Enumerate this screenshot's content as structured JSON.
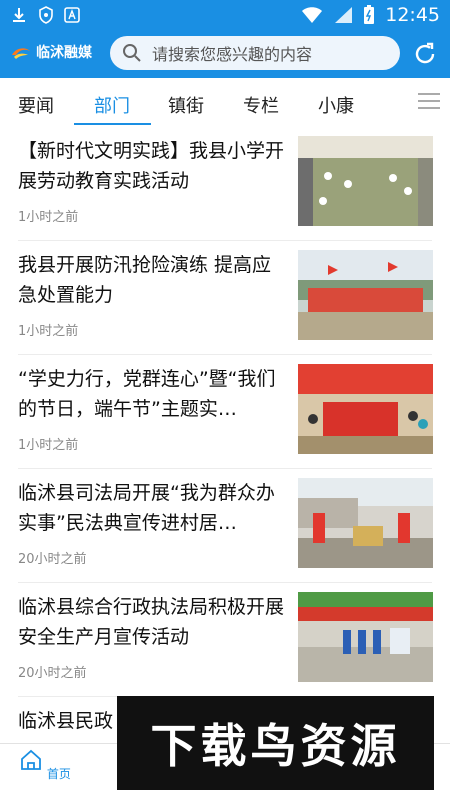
{
  "status_bar": {
    "time": "12:45"
  },
  "header": {
    "logo_text": "临沭融媒",
    "search_placeholder": "请搜索您感兴趣的内容"
  },
  "tabs": [
    {
      "label": "要闻"
    },
    {
      "label": "部门"
    },
    {
      "label": "镇街"
    },
    {
      "label": "专栏"
    },
    {
      "label": "小康"
    }
  ],
  "articles": [
    {
      "title": "【新时代文明实践】我县小学开展劳动教育实践活动",
      "time": "1小时之前"
    },
    {
      "title": "我县开展防汛抢险演练 提高应急处置能力",
      "time": "1小时之前"
    },
    {
      "title": "“学史力行，党群连心”暨“我们的节日，端午节”主题实…",
      "time": "1小时之前"
    },
    {
      "title": "临沭县司法局开展“我为群众办实事”民法典宣传进村居…",
      "time": "20小时之前"
    },
    {
      "title": "临沭县综合行政执法局积极开展安全生产月宣传活动",
      "time": "20小时之前"
    },
    {
      "title": "临沭县民政",
      "time": ""
    }
  ],
  "bottom_nav": [
    {
      "label": "首页"
    },
    {
      "label": ""
    },
    {
      "label": ""
    },
    {
      "label": ""
    },
    {
      "label": ""
    }
  ],
  "watermark": {
    "text": "下载鸟资源"
  },
  "colors": {
    "accent": "#1a8fe3",
    "text": "#111111",
    "muted": "#888888"
  }
}
